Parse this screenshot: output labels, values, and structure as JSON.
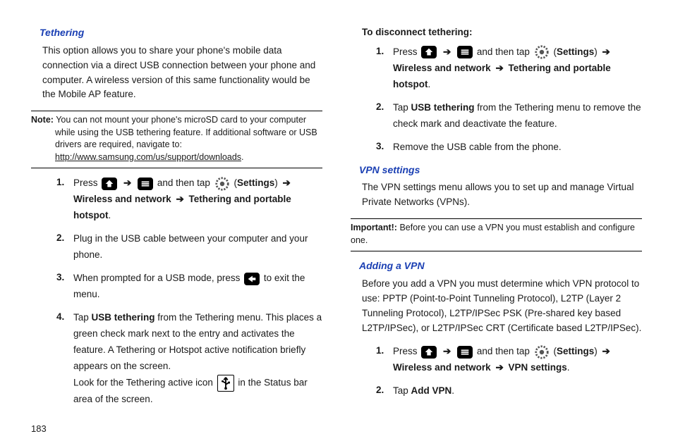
{
  "pageNumber": "183",
  "left": {
    "title": "Tethering",
    "intro": "This option allows you to share your phone's mobile data connection via a direct USB connection between your phone and computer. A wireless version of this same functionality would be the Mobile AP feature.",
    "noteLabel": "Note:",
    "noteText": " You can not mount your phone's microSD card to your computer while using the USB tethering feature. If additional software or USB drivers are required, navigate to: ",
    "noteLink": "http://www.samsung.com/us/support/downloads",
    "notePeriod": ".",
    "steps": [
      {
        "num": "1.",
        "pre": "Press ",
        "mid1": " and then tap ",
        "settings": "Settings",
        "post1": "Wireless and network",
        "post2": "Tethering and portable hotspot",
        "period": "."
      },
      {
        "num": "2.",
        "text": "Plug in the USB cable between your computer and your phone."
      },
      {
        "num": "3.",
        "pre": "When prompted for a USB mode, press ",
        "post": " to exit the menu."
      },
      {
        "num": "4.",
        "pre": "Tap ",
        "bold": "USB tethering",
        "mid": " from the Tethering menu. This places a green check mark next to the entry and activates the feature. A Tethering or Hotspot active notification briefly appears on the screen.",
        "line2a": "Look for the Tethering active icon ",
        "line2b": " in the Status bar area of the screen."
      }
    ]
  },
  "right": {
    "disconnectHead": "To disconnect tethering:",
    "dsteps": [
      {
        "num": "1.",
        "pre": "Press ",
        "mid1": " and then tap ",
        "settings": "Settings",
        "post1": "Wireless and network",
        "post2": "Tethering and portable hotspot",
        "period": "."
      },
      {
        "num": "2.",
        "pre": "Tap ",
        "bold": "USB tethering",
        "post": " from the Tethering menu to remove the check mark and deactivate the feature."
      },
      {
        "num": "3.",
        "text": "Remove the USB cable from the phone."
      }
    ],
    "vpnTitle": "VPN settings",
    "vpnIntro": "The VPN settings menu allows you to set up and manage Virtual Private Networks (VPNs).",
    "impLabel": "Important!:",
    "impText": " Before you can use a VPN you must establish and configure one.",
    "addTitle": "Adding a VPN",
    "addIntro": "Before you add a VPN you must determine which VPN protocol to use: PPTP (Point-to-Point Tunneling Protocol), L2TP (Layer 2 Tunneling Protocol), L2TP/IPSec PSK (Pre-shared key based L2TP/IPSec), or L2TP/IPSec CRT (Certificate based L2TP/IPSec).",
    "asteps": [
      {
        "num": "1.",
        "pre": "Press ",
        "mid1": " and then tap ",
        "settings": "Settings",
        "post1": "Wireless and network",
        "post2": "VPN settings",
        "period": "."
      },
      {
        "num": "2.",
        "pre": "Tap ",
        "bold": "Add VPN",
        "period": "."
      }
    ]
  },
  "arrows": {
    "a": "➔"
  }
}
